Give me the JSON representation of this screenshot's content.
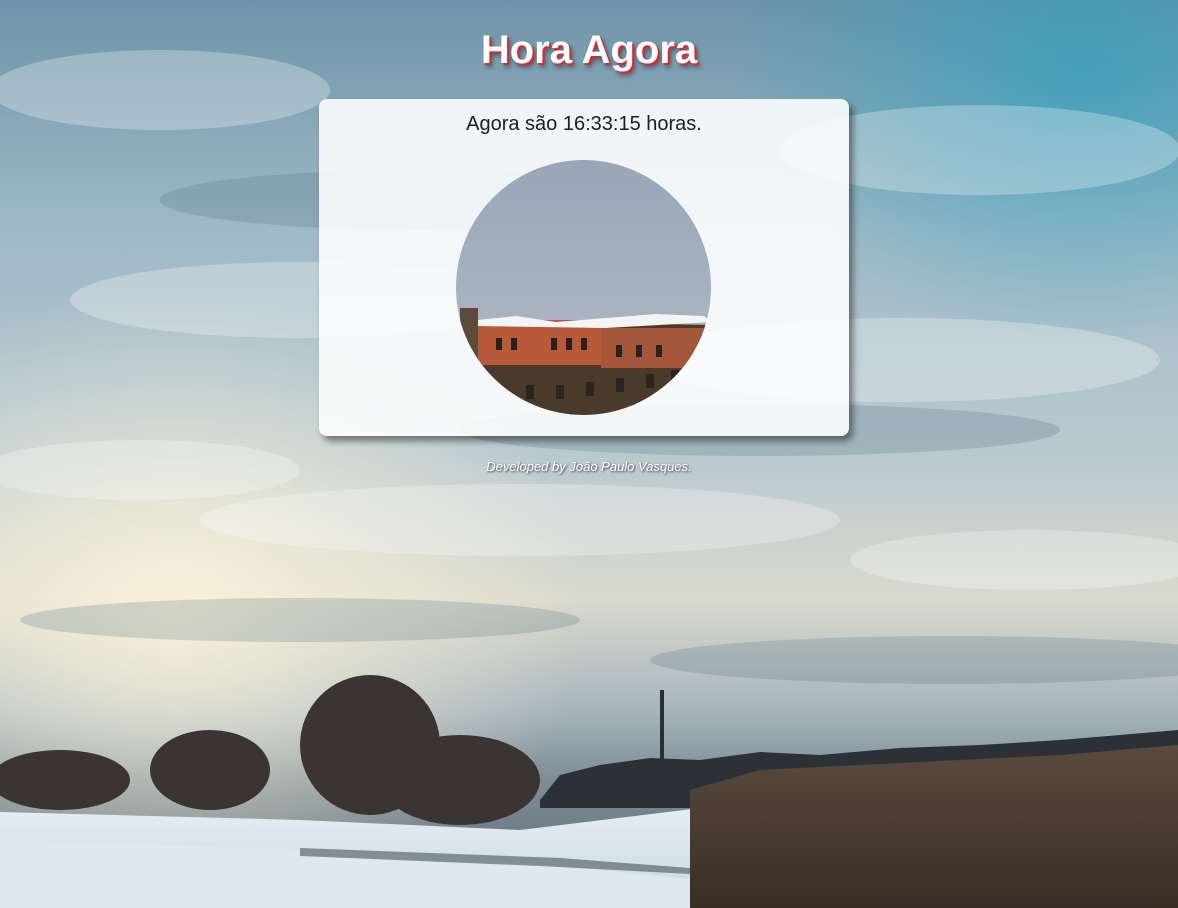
{
  "page": {
    "title": "Hora Agora",
    "clock_message": "Agora são 16:33:15 horas.",
    "footer": "Developed by João Paulo Vasques."
  },
  "clock": {
    "time": "16:33:15",
    "period_image": "afternoon building with snow"
  },
  "background": {
    "scene": "cloudy winter sky over snowy field with trees and reeds"
  },
  "colors": {
    "title_text": "#ffffff",
    "title_shadow": "#e3262a",
    "card_background": "#ffffff",
    "body_text": "#1e1e1e",
    "footer_text": "#ffffff"
  }
}
